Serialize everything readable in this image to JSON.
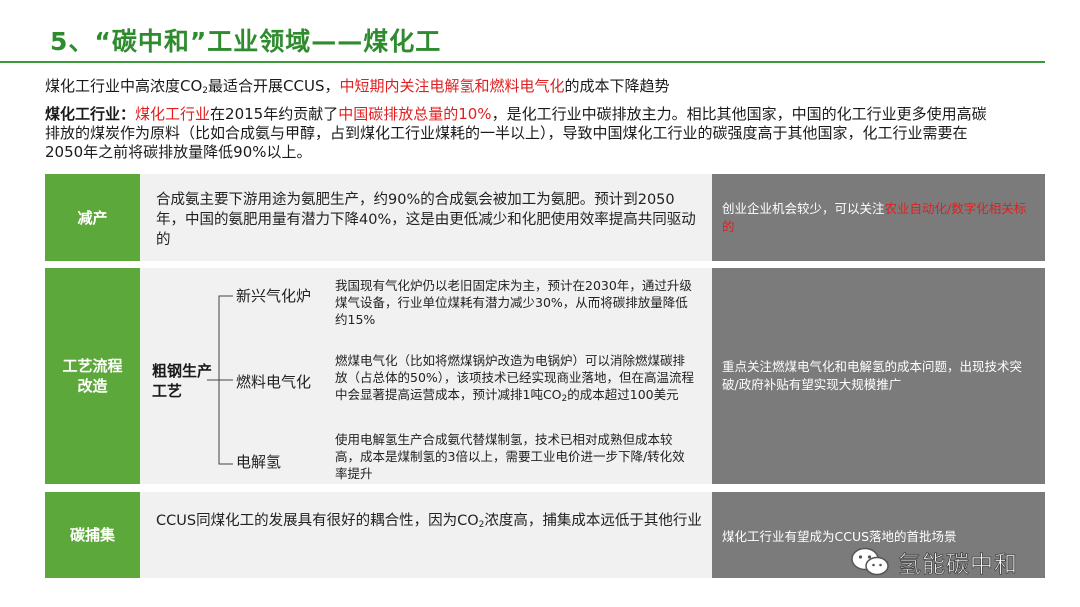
{
  "header": {
    "title": "5、“碳中和”工业领域——煤化工"
  },
  "intro": {
    "line1_a": "煤化工行业中高浓度CO",
    "line1_sub": "2",
    "line1_b": "最适合开展CCUS，",
    "line1_red": "中短期内关注电解氢和燃料电气化",
    "line1_c": "的成本下降趋势",
    "label": "煤化工行业：",
    "p_red1": "煤化工行业",
    "p_a": "在2015年约贡献了",
    "p_red2": "中国碳排放总量的10%",
    "p_b": "，是化工行业中碳排放主力。相比其他国家，中国的化工行业更多使用高碳",
    "p_line2": "排放的煤炭作为原料（比如合成氨与甲醇，占到煤化工行业煤耗的一半以上），导致中国煤化工行业的碳强度高于其他国家，化工行业需要在",
    "p_line3": "2050年之前将碳排放量降低90%以上。"
  },
  "rows": {
    "reduce": {
      "label": "减产",
      "text": "合成氨主要下游用途为氨肥生产，约90%的合成氨会被加工为氨肥。预计到2050年，中国的氨肥用量有潜力下降40%，这是由更低减少和化肥使用效率提高共同驱动的",
      "note_a": "创业企业机会较少，可以关注",
      "note_red": "农业自动化/数字化相关标的"
    },
    "process": {
      "label": "工艺流程改造",
      "center": "粗钢生产工艺",
      "items": [
        {
          "name": "新兴气化炉",
          "text": "我国现有气化炉仍以老旧固定床为主，预计在2030年，通过升级煤气设备，行业单位煤耗有潜力减少30%，从而将碳排放量降低约15%"
        },
        {
          "name": "燃料电气化",
          "text_a": "燃煤电气化（比如将燃煤锅炉改造为电锅炉）可以消除燃煤碳排放（占总体的50%），该项技术已经实现商业落地，但在高温流程中会显著提高运营成本，预计减排1吨CO",
          "text_sub": "2",
          "text_b": "的成本超过100美元"
        },
        {
          "name": "电解氢",
          "text": "使用电解氢生产合成氨代替煤制氢，技术已相对成熟但成本较高，成本是煤制氢的3倍以上，需要工业电价进一步下降/转化效率提升"
        }
      ],
      "note": "重点关注燃煤电气化和电解氢的成本问题，出现技术突破/政府补贴有望实现大规模推广"
    },
    "capture": {
      "label": "碳捕集",
      "text_a": "CCUS同煤化工的发展具有很好的耦合性，因为CO",
      "text_sub": "2",
      "text_b": "浓度高，捕集成本远低于其他行业",
      "note": "煤化工行业有望成为CCUS落地的首批场景"
    }
  },
  "watermark": {
    "text": "氢能碳中和",
    "icon": "wechat-icon"
  }
}
